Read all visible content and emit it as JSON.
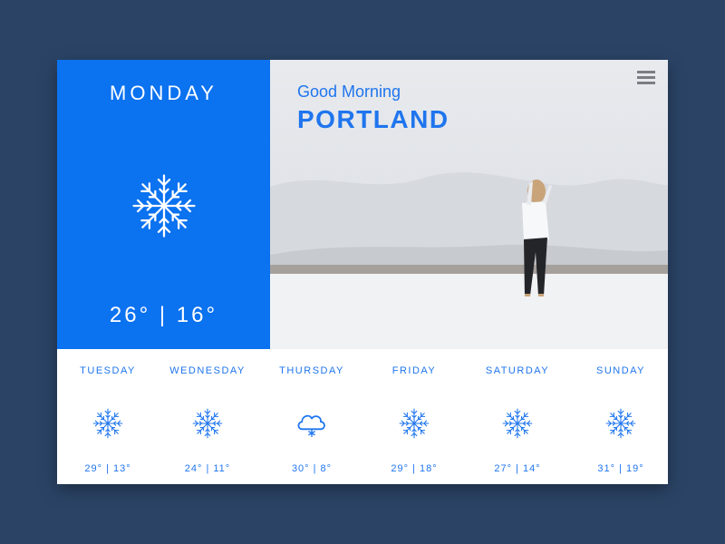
{
  "today": {
    "day": "MONDAY",
    "icon": "snowflake-icon",
    "temps": "26° | 16°"
  },
  "hero": {
    "greeting": "Good Morning",
    "city": "PORTLAND",
    "menu_icon": "hamburger-menu-icon"
  },
  "forecast": [
    {
      "day": "TUESDAY",
      "icon": "snowflake-icon",
      "temps": "29° | 13°"
    },
    {
      "day": "WEDNESDAY",
      "icon": "snowflake-icon",
      "temps": "24° | 11°"
    },
    {
      "day": "THURSDAY",
      "icon": "snow-cloud-icon",
      "temps": "30° | 8°"
    },
    {
      "day": "FRIDAY",
      "icon": "snowflake-icon",
      "temps": "29° | 18°"
    },
    {
      "day": "SATURDAY",
      "icon": "snowflake-icon",
      "temps": "27° | 14°"
    },
    {
      "day": "SUNDAY",
      "icon": "snowflake-icon",
      "temps": "31° | 19°"
    }
  ],
  "colors": {
    "background": "#2b4466",
    "accent": "#0b72f0",
    "text_accent": "#1f75ee",
    "card": "#ffffff"
  }
}
